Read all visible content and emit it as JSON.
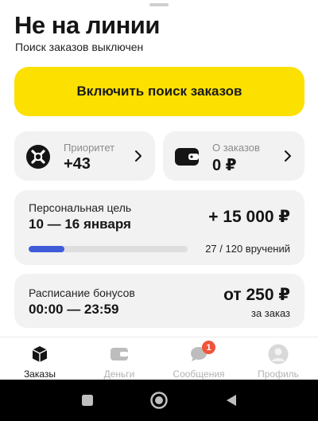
{
  "header": {
    "title": "Не на линии",
    "subtitle": "Поиск заказов выключен"
  },
  "primary_action": {
    "label": "Включить поиск заказов"
  },
  "stats": {
    "priority": {
      "label": "Приоритет",
      "value": "+43",
      "icon": "priority-icon"
    },
    "orders": {
      "label": "О заказов",
      "value": "0 ₽",
      "icon": "wallet-icon"
    }
  },
  "goal": {
    "label": "Персональная цель",
    "dates": "10 — 16 января",
    "amount": "+ 15 000 ₽",
    "progress_text": "27 / 120 вручений",
    "progress_fraction": 0.225
  },
  "bonus": {
    "label": "Расписание бонусов",
    "time": "00:00 — 23:59",
    "amount": "от 250 ₽",
    "note": "за заказ"
  },
  "tabs": [
    {
      "label": "Заказы",
      "icon": "box-icon",
      "active": true
    },
    {
      "label": "Деньги",
      "icon": "wallet-icon",
      "active": false
    },
    {
      "label": "Сообщения",
      "icon": "chat-icon",
      "active": false,
      "badge": "1"
    },
    {
      "label": "Профиль",
      "icon": "avatar",
      "active": false
    }
  ],
  "colors": {
    "accent": "#fce000",
    "progress": "#3f5bd8",
    "badge": "#f0553a"
  }
}
